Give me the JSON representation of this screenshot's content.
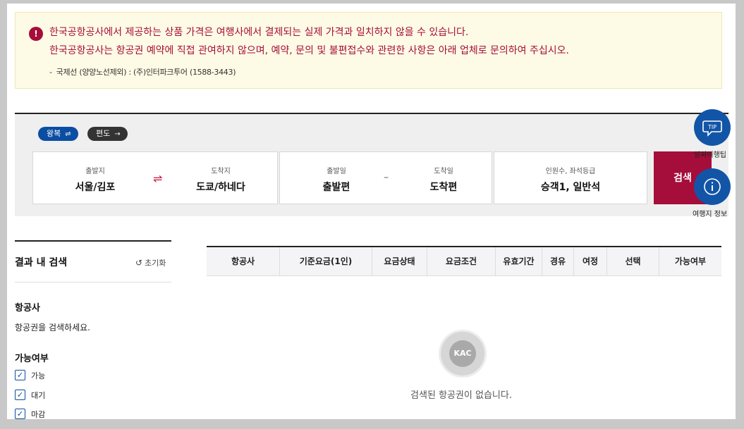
{
  "notice": {
    "icon": "alert-icon",
    "line1": "한국공항공사에서 제공하는 상품 가격은 여행사에서 결제되는 실제 가격과 일치하지 않을 수 있습니다.",
    "line2": "한국공항공사는 항공권 예약에 직접 관여하지 않으며, 예약, 문의 및 불편접수와 관련한 사항은 아래 업체로 문의하여 주십시오.",
    "line3_dash": "-",
    "line3": "국제선 (양양노선제외) : (주)인터파크투어 (1588-3443)"
  },
  "trip_type": {
    "round": "왕복",
    "round_icon": "⇌",
    "oneway": "편도",
    "oneway_icon": "→"
  },
  "search": {
    "depart_label": "출발지",
    "depart_value": "서울/김포",
    "swap_icon": "⇌",
    "arrive_label": "도착지",
    "arrive_value": "도쿄/하네다",
    "depart_date_label": "출발일",
    "depart_date_value": "출발편",
    "date_sep": "–",
    "arrive_date_label": "도착일",
    "arrive_date_value": "도착편",
    "pax_label": "인원수, 좌석등급",
    "pax_value": "승객1, 일반석",
    "button": "검색"
  },
  "floating": {
    "tip_icon_text": "TIP",
    "tip_label": "알짜여행팁",
    "info_label": "여행지 정보"
  },
  "filter": {
    "title": "결과 내 검색",
    "reset": "초기화",
    "airline_heading": "항공사",
    "airline_text": "항공권을 검색하세요.",
    "availability_heading": "가능여부",
    "options": [
      {
        "label": "가능",
        "checked": true
      },
      {
        "label": "대기",
        "checked": true
      },
      {
        "label": "마감",
        "checked": true
      }
    ]
  },
  "table": {
    "columns": [
      "항공사",
      "기준요금(1인)",
      "요금상태",
      "요금조건",
      "유효기간",
      "경유",
      "여정",
      "선택",
      "가능여부"
    ],
    "empty_message": "검색된 항공권이 없습니다.",
    "logo_text": "KAC"
  },
  "colors": {
    "accent_red": "#a50d3a",
    "accent_blue": "#0b4da2"
  }
}
